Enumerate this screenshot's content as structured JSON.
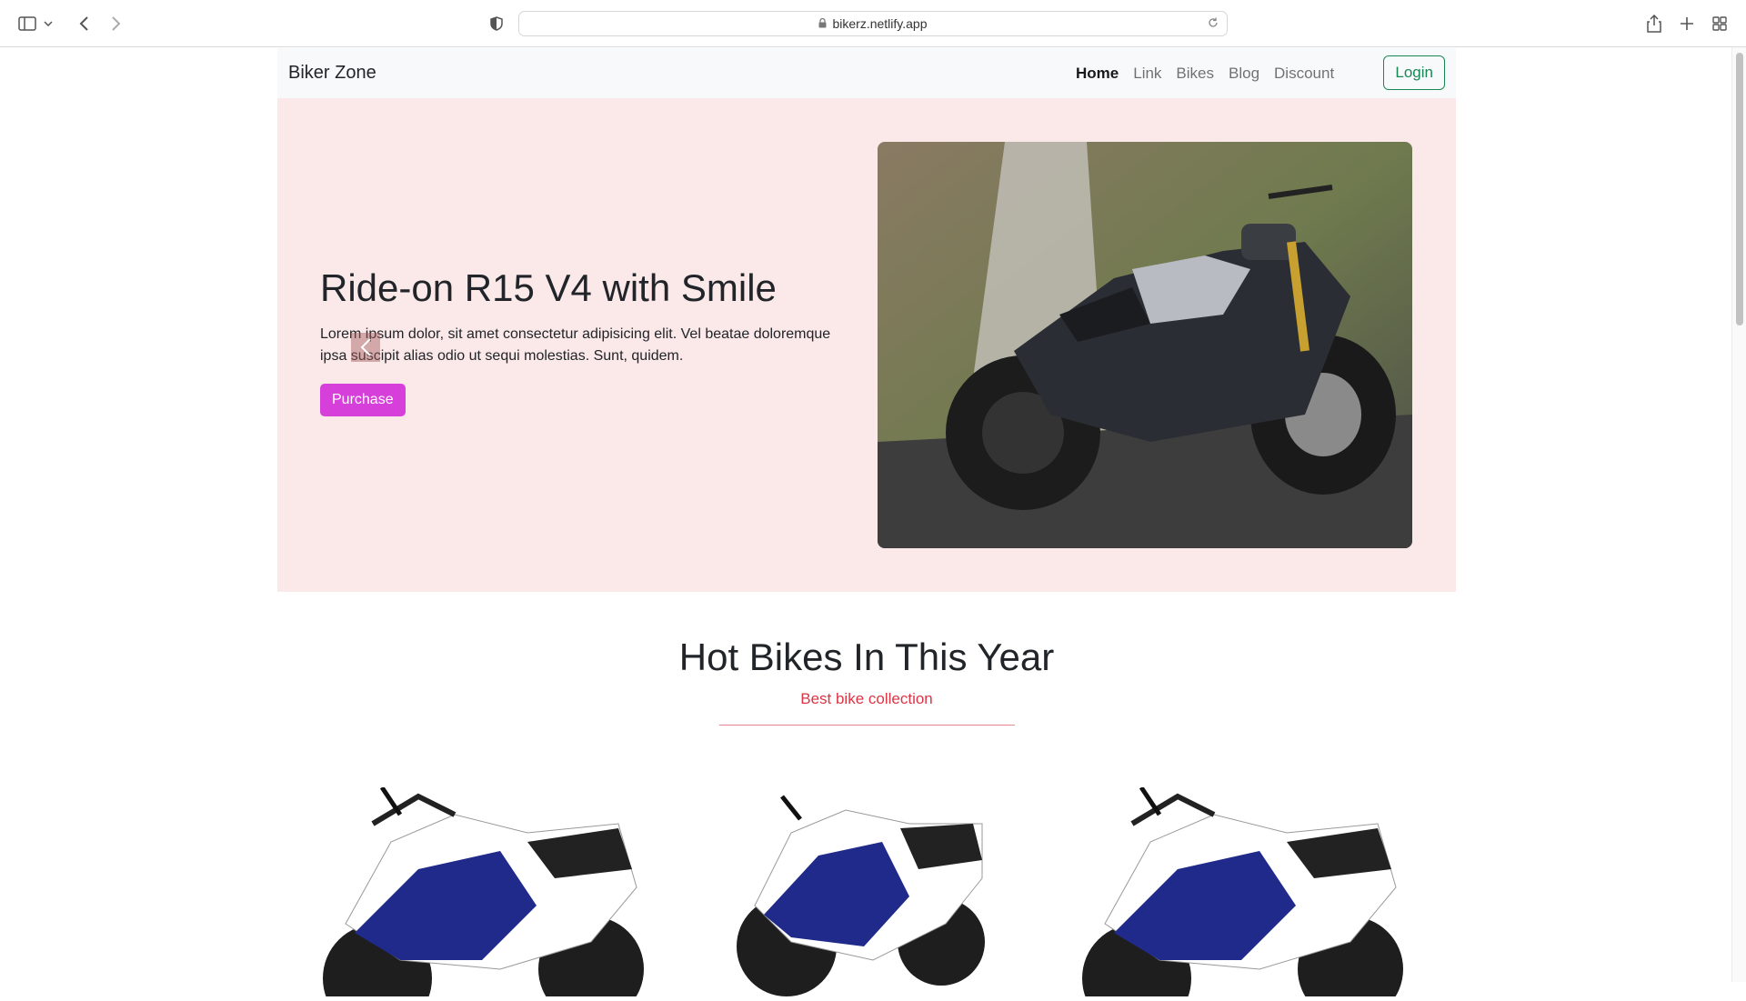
{
  "browser": {
    "url": "bikerz.netlify.app",
    "icons": [
      "sidebar-icon",
      "chevron-down-icon",
      "back-icon",
      "forward-icon",
      "shield-icon",
      "lock-icon",
      "reload-icon",
      "share-icon",
      "new-tab-icon",
      "tab-overview-icon"
    ]
  },
  "navbar": {
    "brand": "Biker Zone",
    "links": [
      {
        "label": "Home",
        "active": true
      },
      {
        "label": "Link",
        "active": false
      },
      {
        "label": "Bikes",
        "active": false
      },
      {
        "label": "Blog",
        "active": false
      },
      {
        "label": "Discount",
        "active": false
      }
    ],
    "login_label": "Login"
  },
  "hero": {
    "title": "Ride-on R15 V4 with Smile",
    "description": "Lorem ipsum dolor, sit amet consectetur adipisicing elit. Vel beatae doloremque ipsa suscipit alias odio ut sequi molestias. Sunt, quidem.",
    "button_label": "Purchase",
    "image_alt": "black-motorcycle-image"
  },
  "hot_bikes": {
    "title": "Hot Bikes In This Year",
    "subtitle": "Best bike collection",
    "items": [
      "blue-white-sport-bike",
      "blue-white-sport-bike",
      "blue-white-sport-bike"
    ]
  },
  "colors": {
    "hero_bg": "#fbe8e8",
    "purchase_bg": "#d63fd9",
    "login_border": "#198754",
    "subtitle": "#dc3545"
  }
}
